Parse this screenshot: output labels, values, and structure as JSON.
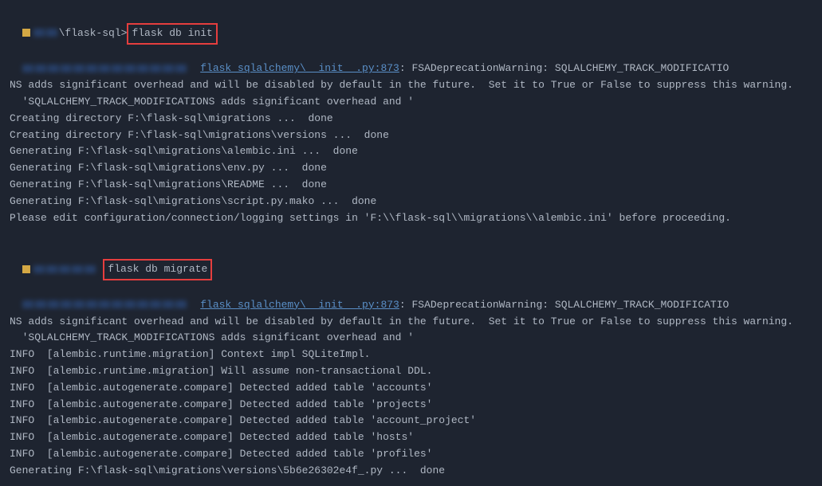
{
  "section1": {
    "prompt_path": "\\flask-sql>",
    "command": "flask db init",
    "warning_link": "flask_sqlalchemy\\__init__.py:873",
    "warning_text1": ": FSADeprecationWarning: SQLALCHEMY_TRACK_MODIFICATIO",
    "warning_text2": "NS adds significant overhead and will be disabled by default in the future.  Set it to True or False to suppress this warning.",
    "warning_text3": "  'SQLALCHEMY_TRACK_MODIFICATIONS adds significant overhead and '",
    "lines": [
      "Creating directory F:\\flask-sql\\migrations ...  done",
      "Creating directory F:\\flask-sql\\migrations\\versions ...  done",
      "Generating F:\\flask-sql\\migrations\\alembic.ini ...  done",
      "Generating F:\\flask-sql\\migrations\\env.py ...  done",
      "Generating F:\\flask-sql\\migrations\\README ...  done",
      "Generating F:\\flask-sql\\migrations\\script.py.mako ...  done",
      "Please edit configuration/connection/logging settings in 'F:\\\\flask-sql\\\\migrations\\\\alembic.ini' before proceeding."
    ]
  },
  "section2": {
    "command": "flask db migrate",
    "warning_link": "flask_sqlalchemy\\__init__.py:873",
    "warning_text1": ": FSADeprecationWarning: SQLALCHEMY_TRACK_MODIFICATIO",
    "warning_text2": "NS adds significant overhead and will be disabled by default in the future.  Set it to True or False to suppress this warning.",
    "warning_text3": "  'SQLALCHEMY_TRACK_MODIFICATIONS adds significant overhead and '",
    "lines": [
      "INFO  [alembic.runtime.migration] Context impl SQLiteImpl.",
      "INFO  [alembic.runtime.migration] Will assume non-transactional DDL.",
      "INFO  [alembic.autogenerate.compare] Detected added table 'accounts'",
      "INFO  [alembic.autogenerate.compare] Detected added table 'projects'",
      "INFO  [alembic.autogenerate.compare] Detected added table 'account_project'",
      "INFO  [alembic.autogenerate.compare] Detected added table 'hosts'",
      "INFO  [alembic.autogenerate.compare] Detected added table 'profiles'",
      "Generating F:\\flask-sql\\migrations\\versions\\5b6e26302e4f_.py ...  done"
    ]
  }
}
